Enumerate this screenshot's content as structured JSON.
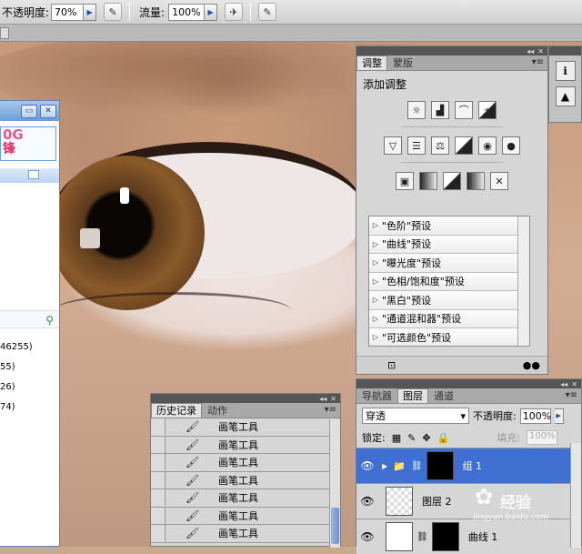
{
  "options_bar": {
    "opacity_label": "不透明度:",
    "opacity_value": "70%",
    "flow_label": "流量:",
    "flow_value": "100%"
  },
  "qq_window": {
    "ad_line1": "0G",
    "ad_line2": "锋",
    "contacts": [
      "46255)",
      "55)",
      "26)",
      "74)"
    ]
  },
  "adjustments": {
    "tabs": [
      "调整",
      "蒙版"
    ],
    "header": "添加调整",
    "icon_rows": [
      [
        "brightness-contrast-icon",
        "levels-icon",
        "curves-icon",
        "exposure-icon"
      ],
      [
        "vibrance-icon",
        "hue-saturation-icon",
        "color-balance-icon",
        "black-white-icon",
        "photo-filter-icon",
        "channel-mixer-icon"
      ],
      [
        "invert-icon",
        "posterize-icon",
        "threshold-icon",
        "gradient-map-icon",
        "selective-color-icon"
      ]
    ],
    "presets": [
      "\"色阶\"预设",
      "\"曲线\"预设",
      "\"曝光度\"预设",
      "\"色相/饱和度\"预设",
      "\"黑白\"预设",
      "\"通道混和器\"预设",
      "\"可选颜色\"预设"
    ]
  },
  "layers": {
    "tabs": [
      "导航器",
      "图层",
      "通道"
    ],
    "blend_mode": "穿透",
    "opacity_label": "不透明度:",
    "opacity_value": "100%",
    "lock_label": "锁定:",
    "fill_label": "填充:",
    "fill_value": "100%",
    "items": [
      {
        "name": "组 1",
        "selected": true
      },
      {
        "name": "图层 2",
        "selected": false
      },
      {
        "name": "曲线 1",
        "selected": false
      }
    ]
  },
  "history": {
    "tabs": [
      "历史记录",
      "动作"
    ],
    "items": [
      "画笔工具",
      "画笔工具",
      "画笔工具",
      "画笔工具",
      "画笔工具",
      "画笔工具",
      "画笔工具"
    ]
  },
  "watermark": {
    "brand": "经验",
    "url": "jingyan.baidu.com"
  },
  "colors": {
    "selection": "#3f6fd1",
    "panel": "#d6d6d6",
    "ad_pink": "#e05a8c"
  }
}
